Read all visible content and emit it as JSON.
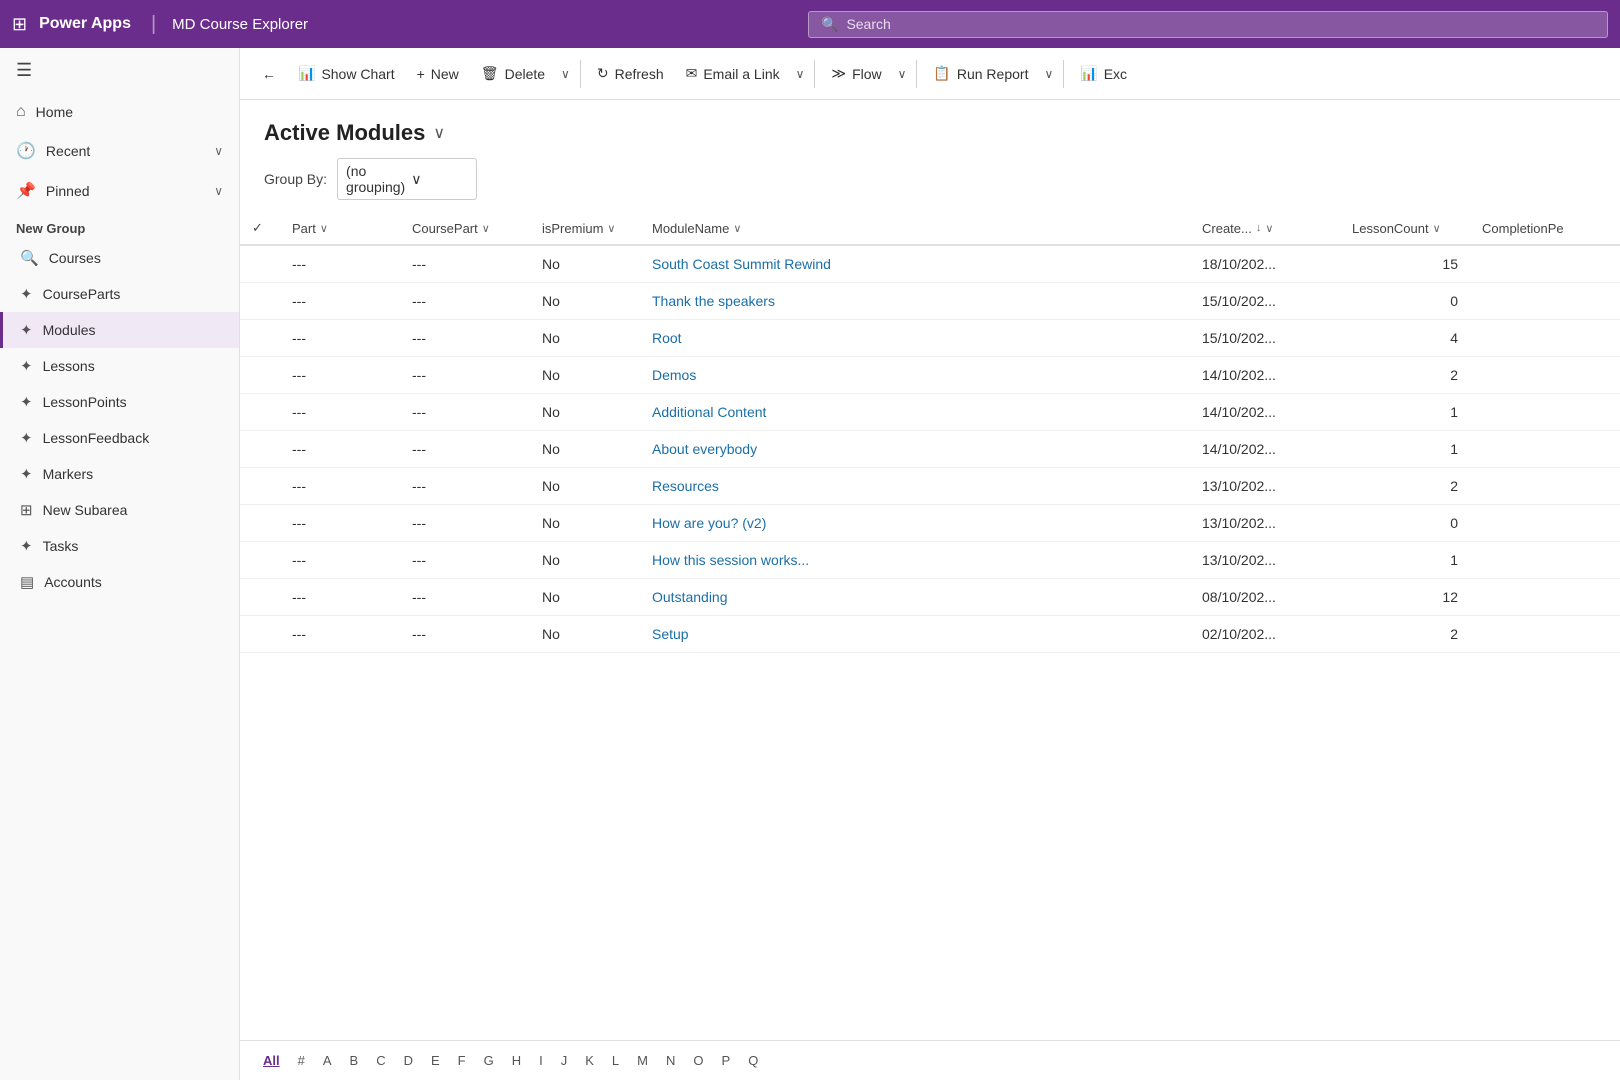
{
  "header": {
    "grid_icon": "⊞",
    "app_name": "Power Apps",
    "divider": "|",
    "app_subtitle": "MD Course Explorer",
    "search_placeholder": "Search"
  },
  "sidebar": {
    "hamburger": "☰",
    "nav_items": [
      {
        "id": "home",
        "icon": "⌂",
        "label": "Home"
      },
      {
        "id": "recent",
        "icon": "🕐",
        "label": "Recent",
        "chevron": "∨"
      },
      {
        "id": "pinned",
        "icon": "📌",
        "label": "Pinned",
        "chevron": "∨"
      }
    ],
    "new_group_label": "New Group",
    "sub_items": [
      {
        "id": "courses",
        "icon": "🔍",
        "label": "Courses"
      },
      {
        "id": "courseparts",
        "icon": "✦",
        "label": "CourseParts"
      },
      {
        "id": "modules",
        "icon": "✦",
        "label": "Modules",
        "active": true
      },
      {
        "id": "lessons",
        "icon": "✦",
        "label": "Lessons"
      },
      {
        "id": "lessonpoints",
        "icon": "✦",
        "label": "LessonPoints"
      },
      {
        "id": "lessonfeedback",
        "icon": "✦",
        "label": "LessonFeedback"
      },
      {
        "id": "markers",
        "icon": "✦",
        "label": "Markers"
      },
      {
        "id": "newsubarea",
        "icon": "⊞",
        "label": "New Subarea"
      },
      {
        "id": "tasks",
        "icon": "✦",
        "label": "Tasks"
      },
      {
        "id": "accounts",
        "icon": "▤",
        "label": "Accounts"
      }
    ]
  },
  "toolbar": {
    "back_icon": "←",
    "show_chart": {
      "icon": "📊",
      "label": "Show Chart"
    },
    "new": {
      "icon": "+",
      "label": "New"
    },
    "delete": {
      "icon": "🗑",
      "label": "Delete"
    },
    "refresh": {
      "icon": "↻",
      "label": "Refresh"
    },
    "email_link": {
      "icon": "✉",
      "label": "Email a Link"
    },
    "flow": {
      "icon": "≫",
      "label": "Flow"
    },
    "run_report": {
      "icon": "📋",
      "label": "Run Report"
    },
    "exc": {
      "icon": "📊",
      "label": "Exc"
    }
  },
  "content": {
    "page_title": "Active Modules",
    "group_by_label": "Group By:",
    "group_by_value": "(no grouping)",
    "columns": [
      {
        "key": "check",
        "label": ""
      },
      {
        "key": "part",
        "label": "Part"
      },
      {
        "key": "coursepart",
        "label": "CoursePart"
      },
      {
        "key": "ispremium",
        "label": "isPremium"
      },
      {
        "key": "modulename",
        "label": "ModuleName"
      },
      {
        "key": "created",
        "label": "Create..."
      },
      {
        "key": "lessoncount",
        "label": "LessonCount"
      },
      {
        "key": "completionpe",
        "label": "CompletionPe"
      }
    ],
    "rows": [
      {
        "part": "---",
        "coursepart": "---",
        "ispremium": "No",
        "modulename": "South Coast Summit Rewind",
        "created": "18/10/202...",
        "lessoncount": 15,
        "completionpe": ""
      },
      {
        "part": "---",
        "coursepart": "---",
        "ispremium": "No",
        "modulename": "Thank the speakers",
        "created": "15/10/202...",
        "lessoncount": 0,
        "completionpe": ""
      },
      {
        "part": "---",
        "coursepart": "---",
        "ispremium": "No",
        "modulename": "Root",
        "created": "15/10/202...",
        "lessoncount": 4,
        "completionpe": ""
      },
      {
        "part": "---",
        "coursepart": "---",
        "ispremium": "No",
        "modulename": "Demos",
        "created": "14/10/202...",
        "lessoncount": 2,
        "completionpe": ""
      },
      {
        "part": "---",
        "coursepart": "---",
        "ispremium": "No",
        "modulename": "Additional Content",
        "created": "14/10/202...",
        "lessoncount": 1,
        "completionpe": ""
      },
      {
        "part": "---",
        "coursepart": "---",
        "ispremium": "No",
        "modulename": "About everybody",
        "created": "14/10/202...",
        "lessoncount": 1,
        "completionpe": ""
      },
      {
        "part": "---",
        "coursepart": "---",
        "ispremium": "No",
        "modulename": "Resources",
        "created": "13/10/202...",
        "lessoncount": 2,
        "completionpe": ""
      },
      {
        "part": "---",
        "coursepart": "---",
        "ispremium": "No",
        "modulename": "How are you? (v2)",
        "created": "13/10/202...",
        "lessoncount": 0,
        "completionpe": ""
      },
      {
        "part": "---",
        "coursepart": "---",
        "ispremium": "No",
        "modulename": "How this session works...",
        "created": "13/10/202...",
        "lessoncount": 1,
        "completionpe": ""
      },
      {
        "part": "---",
        "coursepart": "---",
        "ispremium": "No",
        "modulename": "Outstanding",
        "created": "08/10/202...",
        "lessoncount": 12,
        "completionpe": ""
      },
      {
        "part": "---",
        "coursepart": "---",
        "ispremium": "No",
        "modulename": "Setup",
        "created": "02/10/202...",
        "lessoncount": 2,
        "completionpe": ""
      }
    ]
  },
  "pagination": {
    "active": "All",
    "letters": [
      "All",
      "#",
      "A",
      "B",
      "C",
      "D",
      "E",
      "F",
      "G",
      "H",
      "I",
      "J",
      "K",
      "L",
      "M",
      "N",
      "O",
      "P",
      "Q"
    ]
  }
}
